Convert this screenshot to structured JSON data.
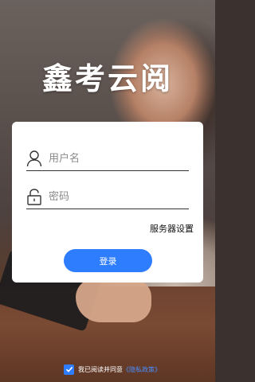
{
  "app": {
    "title": "鑫考云阅"
  },
  "login": {
    "username_placeholder": "用户名",
    "password_placeholder": "密码",
    "server_settings": "服务器设置",
    "login_label": "登录"
  },
  "agreement": {
    "prefix": "我已阅读并同意",
    "open_quote": "《",
    "link": "隐私政策",
    "close_quote": "》",
    "checked": true
  },
  "colors": {
    "accent": "#2f7dff",
    "link": "#4a8dff"
  },
  "icons": {
    "username": "user-icon",
    "password": "lock-icon",
    "check": "check-icon"
  }
}
